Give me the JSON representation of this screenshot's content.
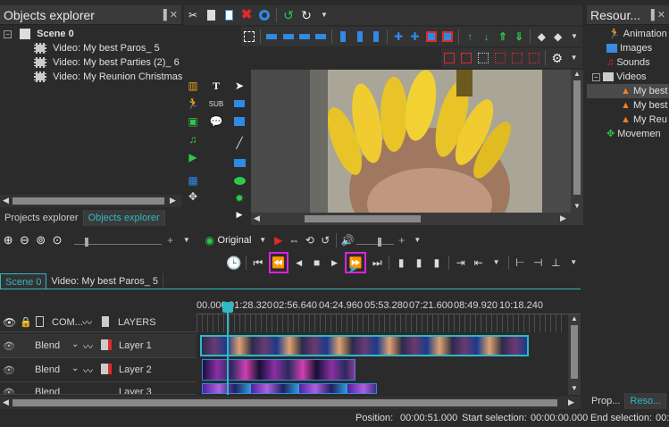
{
  "objects_explorer": {
    "title": "Objects explorer",
    "pin": "▐ ✕",
    "scene": "Scene 0",
    "items": [
      "Video: My best Paros_ 5",
      "Video: My best Parties (2)_ 6",
      "Video: My Reunion Christmas"
    ],
    "tabs": [
      "Projects explorer",
      "Objects explorer"
    ]
  },
  "resources": {
    "title": "Resour...",
    "pin": "▐ ✕",
    "items": [
      "Animation",
      "Images",
      "Sounds",
      "Videos",
      "My best",
      "My best",
      "My Reu",
      "Movemen"
    ],
    "tabs": [
      "Prop...",
      "Reso..."
    ]
  },
  "preview": {
    "zoom_label": "Original",
    "scene_tab": "Scene 0",
    "video_tab": "Video: My best Paros_ 5"
  },
  "timeline": {
    "ruler": [
      "00.000",
      "01:28.320",
      "02:56.640",
      "04:24.960",
      "05:53.280",
      "07:21.600",
      "08:49.920",
      "10:18.240"
    ],
    "header_com": "COM...",
    "header_layers": "LAYERS",
    "rows": [
      {
        "blend": "Blend",
        "layer": "Layer 1"
      },
      {
        "blend": "Blend",
        "layer": "Layer 2"
      },
      {
        "blend": "Blend",
        "layer": "Layer 3"
      }
    ]
  },
  "status": {
    "position_label": "Position:",
    "position_value": "00:00:51.000",
    "start_label": "Start selection:",
    "start_value": "00:00:00.000",
    "end_label": "End selection:",
    "end_value": "00:0"
  },
  "colors": {
    "accent": "#2fb8c6",
    "highlight_box": "#e020e0",
    "red": "#e02a2a",
    "green": "#2fc84a",
    "blue": "#2f8ae6"
  }
}
